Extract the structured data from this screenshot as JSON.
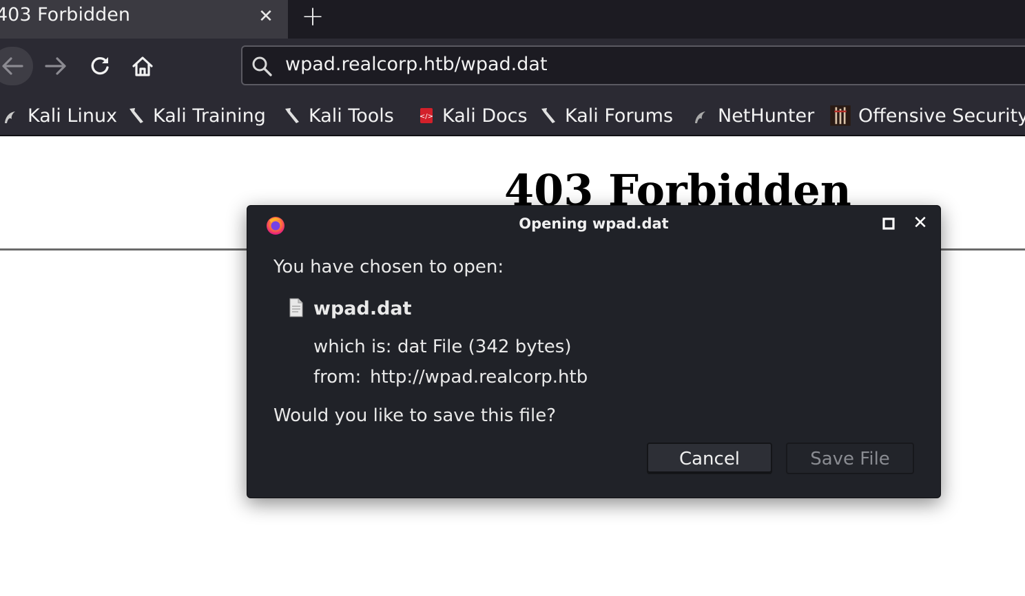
{
  "tab": {
    "title": "403 Forbidden"
  },
  "navbar": {
    "url": "wpad.realcorp.htb/wpad.dat"
  },
  "bookmarks": [
    {
      "label": "Kali Linux",
      "icon": "kali-dragon-icon"
    },
    {
      "label": "Kali Training",
      "icon": "kali-dragon-icon"
    },
    {
      "label": "Kali Tools",
      "icon": "kali-dragon-icon"
    },
    {
      "label": "Kali Docs",
      "icon": "kali-docs-icon"
    },
    {
      "label": "Kali Forums",
      "icon": "kali-dragon-icon"
    },
    {
      "label": "NetHunter",
      "icon": "nethunter-icon"
    },
    {
      "label": "Offensive Security",
      "icon": "offsec-icon"
    }
  ],
  "page": {
    "heading": "403 Forbidden"
  },
  "dialog": {
    "title": "Opening wpad.dat",
    "prompt": "You have chosen to open:",
    "file_name": "wpad.dat",
    "which_label": "which is:",
    "which_value": "dat File (342 bytes)",
    "from_label": "from:",
    "from_value": "http://wpad.realcorp.htb",
    "question": "Would you like to save this file?",
    "cancel_label": "Cancel",
    "save_label": "Save File"
  },
  "colors": {
    "tab_bar": "#1c1b22",
    "toolbar": "#2b2a33",
    "dialog_bg": "#202228",
    "text_light": "#f2f2f2"
  }
}
